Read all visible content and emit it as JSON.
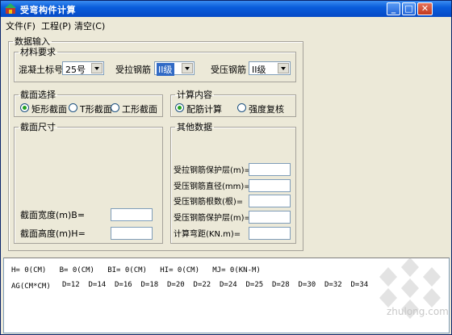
{
  "window": {
    "title": "受弯构件计算"
  },
  "titlebar": {
    "min": "_",
    "max": "□",
    "close": "✕"
  },
  "menu": [
    "文件(F)",
    "工程(P)",
    "清空(C)"
  ],
  "data_input": {
    "legend": "数据输入",
    "material": {
      "legend": "材料要求",
      "concrete_label": "混凝土标号",
      "concrete_value": "25号",
      "tension_label": "受拉钢筋",
      "tension_value": "II级",
      "compression_label": "受压钢筋",
      "compression_value": "II级"
    },
    "section_select": {
      "legend": "截面选择",
      "options": [
        "矩形截面",
        "T形截面",
        "工形截面"
      ],
      "selected": 0
    },
    "calc_content": {
      "legend": "计算内容",
      "options": [
        "配筋计算",
        "强度复核"
      ],
      "selected": 0
    },
    "section_size": {
      "legend": "截面尺寸",
      "width_label": "截面宽度(m)B=",
      "width_value": "",
      "height_label": "截面高度(m)H=",
      "height_value": ""
    },
    "other_data": {
      "legend": "其他数据",
      "fields": [
        {
          "label": "受拉钢筋保护层(m)=",
          "value": ""
        },
        {
          "label": "受压钢筋直径(mm)=",
          "value": ""
        },
        {
          "label": "受压钢筋根数(根)=",
          "value": ""
        },
        {
          "label": "受压钢筋保护层(m)=",
          "value": ""
        },
        {
          "label": "计算弯距(KN.m)=",
          "value": ""
        }
      ]
    }
  },
  "output": {
    "line1": "H= 0(CM)   B= 0(CM)   BI= 0(CM)   HI= 0(CM)   MJ= 0(KN-M)",
    "line2_prefix": "AG(CM*CM)",
    "diameters": [
      "D=12",
      "D=14",
      "D=16",
      "D=18",
      "D=20",
      "D=22",
      "D=24",
      "D=25",
      "D=28",
      "D=30",
      "D=32",
      "D=34"
    ]
  },
  "watermark": {
    "text": "zhulong.com"
  },
  "colors": {
    "titlebar": "#0a5ddb",
    "selection": "#316ac5",
    "radio_dot": "#21a121"
  }
}
